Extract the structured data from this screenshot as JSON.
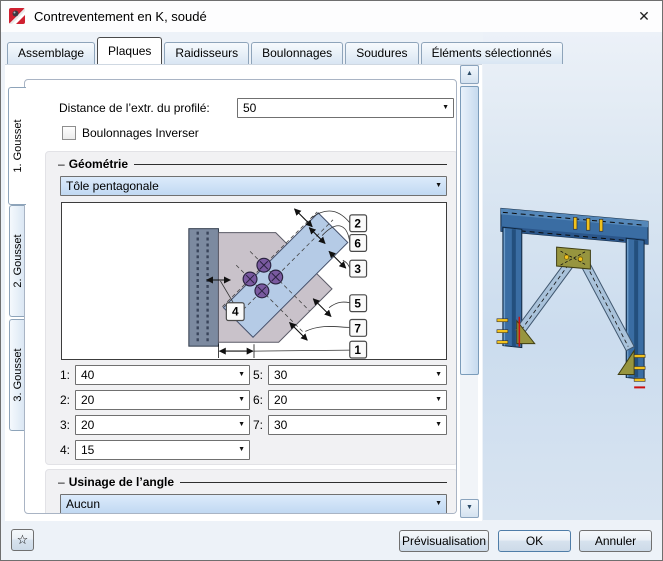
{
  "window": {
    "title": "Contreventement en K, soudé"
  },
  "icons": {
    "close": "✕",
    "dropdown_arrow": "▼",
    "scroll_up": "▲",
    "scroll_down": "▼",
    "star": "☆"
  },
  "tabs": [
    {
      "label": "Assemblage"
    },
    {
      "label": "Plaques"
    },
    {
      "label": "Raidisseurs"
    },
    {
      "label": "Boulonnages"
    },
    {
      "label": "Soudures"
    },
    {
      "label": "Éléments sélectionnés"
    }
  ],
  "side_tabs": [
    {
      "label": "1. Gousset"
    },
    {
      "label": "2. Gousset"
    },
    {
      "label": "3. Gousset"
    }
  ],
  "content": {
    "distance_label": "Distance de l’extr. du profilé:",
    "distance_value": "50",
    "invert_checkbox_label": "Boulonnages Inverser",
    "group_dash": "–",
    "geometry": {
      "title": "Géométrie",
      "shape_value": "Tôle pentagonale",
      "params": [
        {
          "label": "1:",
          "value": "40"
        },
        {
          "label": "2:",
          "value": "20"
        },
        {
          "label": "3:",
          "value": "20"
        },
        {
          "label": "4:",
          "value": "15"
        },
        {
          "label": "5:",
          "value": "30"
        },
        {
          "label": "6:",
          "value": "20"
        },
        {
          "label": "7:",
          "value": "30"
        }
      ],
      "callouts": {
        "c1": "1",
        "c2": "2",
        "c3": "3",
        "c4": "4",
        "c5": "5",
        "c6": "6",
        "c7": "7"
      }
    },
    "corner": {
      "title": "Usinage de l’angle",
      "value": "Aucun"
    }
  },
  "footer": {
    "preview_label": "Prévisualisation",
    "ok_label": "OK",
    "cancel_label": "Annuler"
  },
  "colors": {
    "selection_top": "#dcebfb",
    "selection_bottom": "#c1d9f2",
    "steel_blue": "#3a6da3",
    "brace_blue": "#a9c2da",
    "gusset_olive": "#97953f",
    "plate_blue": "#b5cbe6",
    "gusset_mauve": "#c9c2ca",
    "bolt_purple": "#7a5aa0"
  }
}
